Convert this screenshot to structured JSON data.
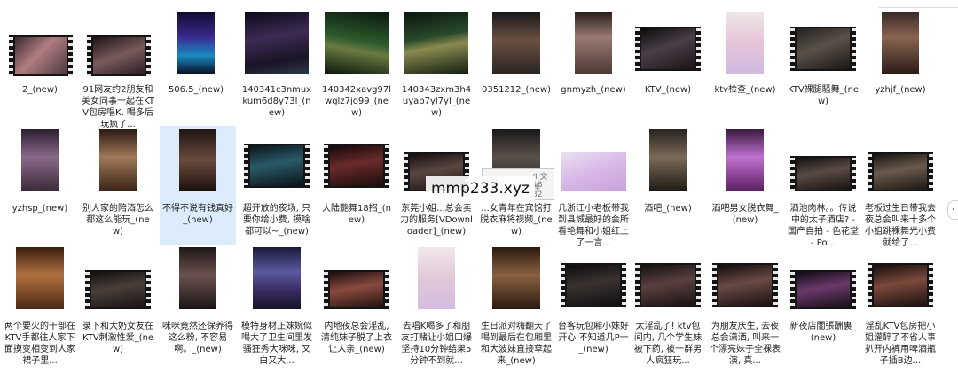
{
  "files": [
    {
      "label": "2_(new)"
    },
    {
      "label": "91网友约2朋友和美女同事一起在KTV包房唱K, 喝多后玩疯了..."
    },
    {
      "label": "506.5_(new)"
    },
    {
      "label": "140341c3nmuxkum6d8y73l_(new)"
    },
    {
      "label": "140342xavg97lwglz7jo99_(new)"
    },
    {
      "label": "140343zxm3h4uyap7yl7yl_(new)"
    },
    {
      "label": "0351212_(new)"
    },
    {
      "label": "gnmyzh_(new)"
    },
    {
      "label": "KTV_(new)"
    },
    {
      "label": "ktv检查_(new)"
    },
    {
      "label": "KTV裸腿騷舞_(new)"
    },
    {
      "label": "yzhjf_(new)"
    },
    {
      "label": "yzhsp_(new)"
    },
    {
      "label": "别人家的陪酒怎么都这么能玩_(new)"
    },
    {
      "label": "不得不说有钱真好_(new)"
    },
    {
      "label": "超开放的夜场, 只要你给小费, 摸啥都可以~_(new)"
    },
    {
      "label": "大陆艷舞18招_(new)"
    },
    {
      "label": "东莞小姐...总会卖力的服务[VDownloader]_(new)"
    },
    {
      "label": "...女青年在宾馆打脱衣麻将视频_(new)"
    },
    {
      "label": "几浙江小老板带我到县城最好的会所看艳舞和小姐红上了一言..."
    },
    {
      "label": "酒吧_(new)"
    },
    {
      "label": "酒吧男女脱衣舞_(new)"
    },
    {
      "label": "酒池肉林。。传说中的太子酒店? - 国产自拍 - 色花堂 - Po..."
    },
    {
      "label": "老板过生日带我去夜总会叫来十多个小姐跳裸舞光小费就给了..."
    },
    {
      "label": "两个要火的干部在KTV手都往人家下面摸变相变到人家裙子里..."
    },
    {
      "label": "录下和大奶女友在KTV刺激性爱_(new)"
    },
    {
      "label": "咪咪竟然还保养得这么粉, 不容易啊。_(new)"
    },
    {
      "label": "模特身材正妹婉似喝大了卫生间里发骚狂秀大咪咪, 又白又大..."
    },
    {
      "label": "内地夜总会淫乱, 清纯妹子脱了上衣让人亲_(new)"
    },
    {
      "label": "去唱K喝多了和朋友打赌让小姐口爆坚持10分钟结果5分钟不到就..."
    },
    {
      "label": "生日派对嗨翻天了 喝到最后在包厢里和大波妹直接草起来_(new)"
    },
    {
      "label": "台客玩包厢小妹好开心 不知道几P一_(new)"
    },
    {
      "label": "太淫乱了! ktv包间内, 几个学生妹被下药, 被一群男人疯狂玩..."
    },
    {
      "label": "为朋友庆生, 去夜总会潇洒, 叫来一个漂亮妹子全裸表演, 真..."
    },
    {
      "label": "新夜店闇張酬裏_(new)"
    },
    {
      "label": "淫乱KTV包房把小姐灌醉了不省人事扒开内裤用啤酒瓶子插B边..."
    }
  ],
  "tooltip": {
    "line1": "/I  文件",
    "line2": "18",
    "line3": "82"
  },
  "watermark": "mmp233.xyz",
  "icons": {
    "scroll": "chevron-left-icon"
  },
  "colors": {
    "selected": "#dcecfc",
    "film": "#141414"
  }
}
